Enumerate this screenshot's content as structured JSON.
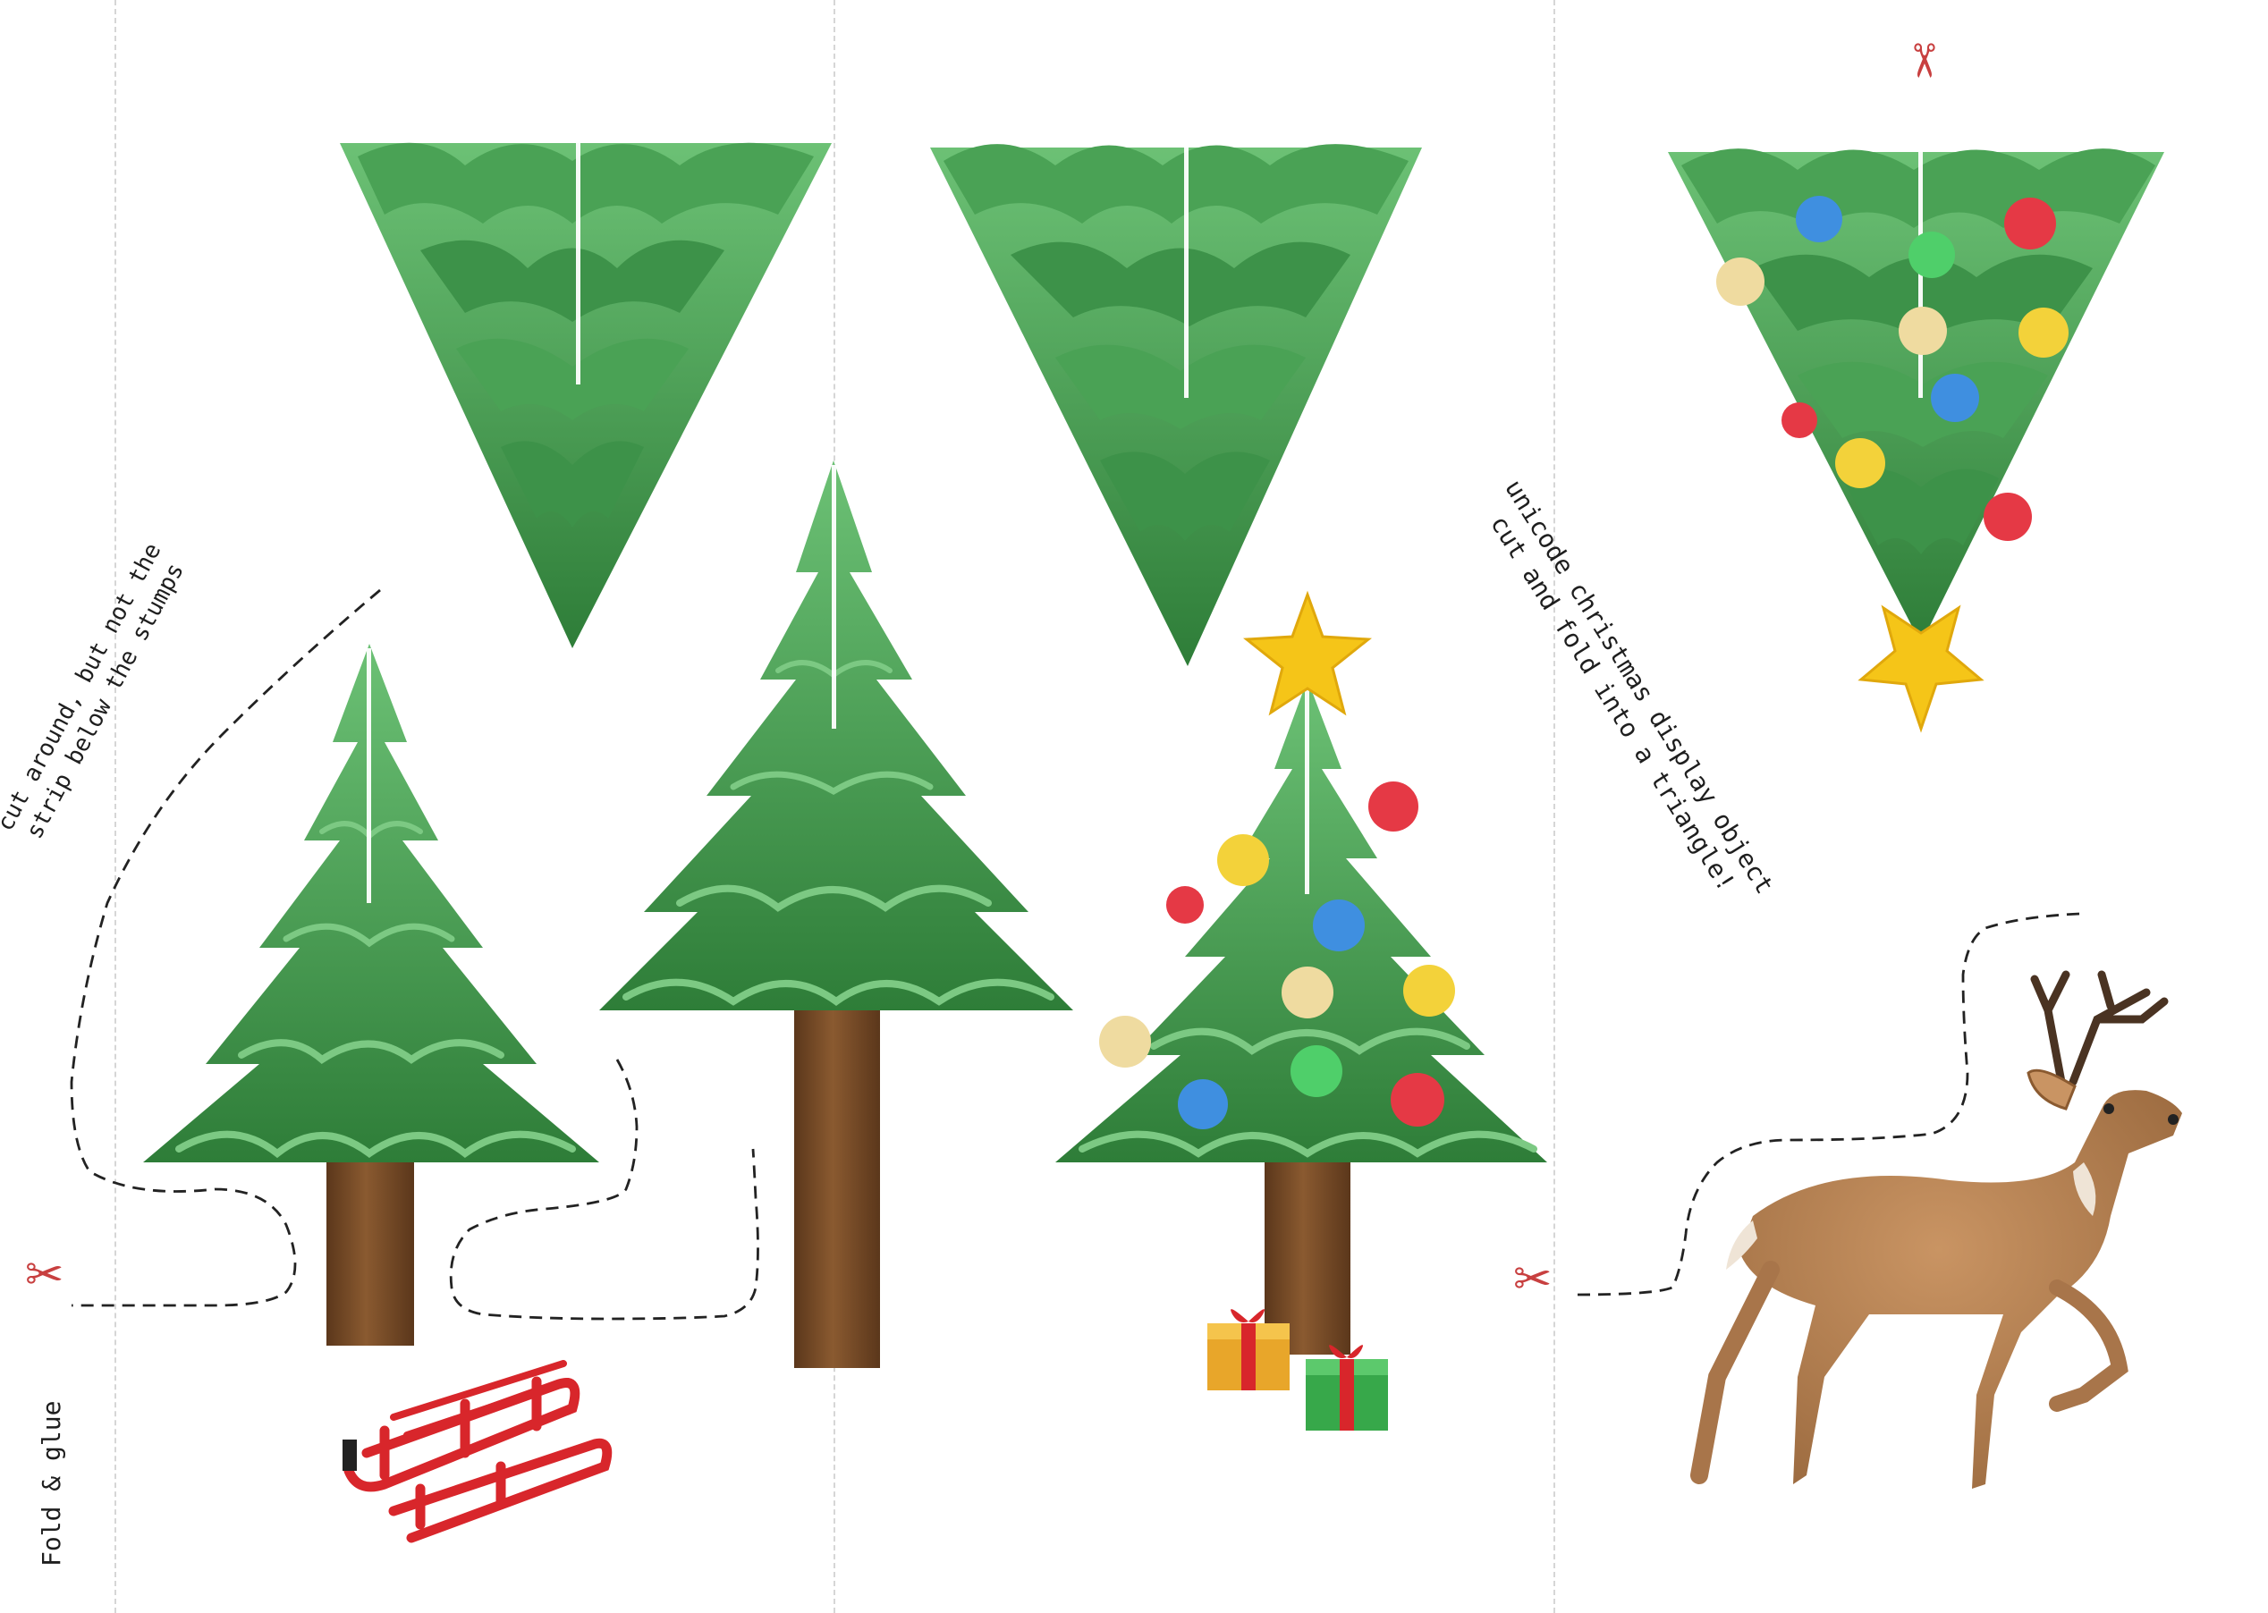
{
  "instructions": {
    "cut_line_1": "cut around, but not the",
    "cut_line_2": "strip below the stumps",
    "title_line_1": "unicode christmas display object",
    "title_line_2": "cut and fold into a triangle!",
    "fold_glue": "Fold & glue"
  },
  "icons": {
    "scissors": "✂"
  },
  "colors": {
    "foliage_dark": "#2f7a3a",
    "foliage_mid": "#4aa255",
    "foliage_light": "#7cc983",
    "trunk": "#7a4e2a",
    "trunk_dark": "#5b371b",
    "star": "#f5c518",
    "ornament_red": "#e53945",
    "ornament_blue": "#3f8fe0",
    "ornament_yellow": "#f3d23a",
    "ornament_cream": "#efdba0",
    "ornament_green": "#4fcf6a",
    "sled": "#d8262b",
    "deer": "#b07b4e",
    "cut_line": "#222222",
    "fold_line": "#d6d6d6",
    "scissors": "#c84040"
  }
}
